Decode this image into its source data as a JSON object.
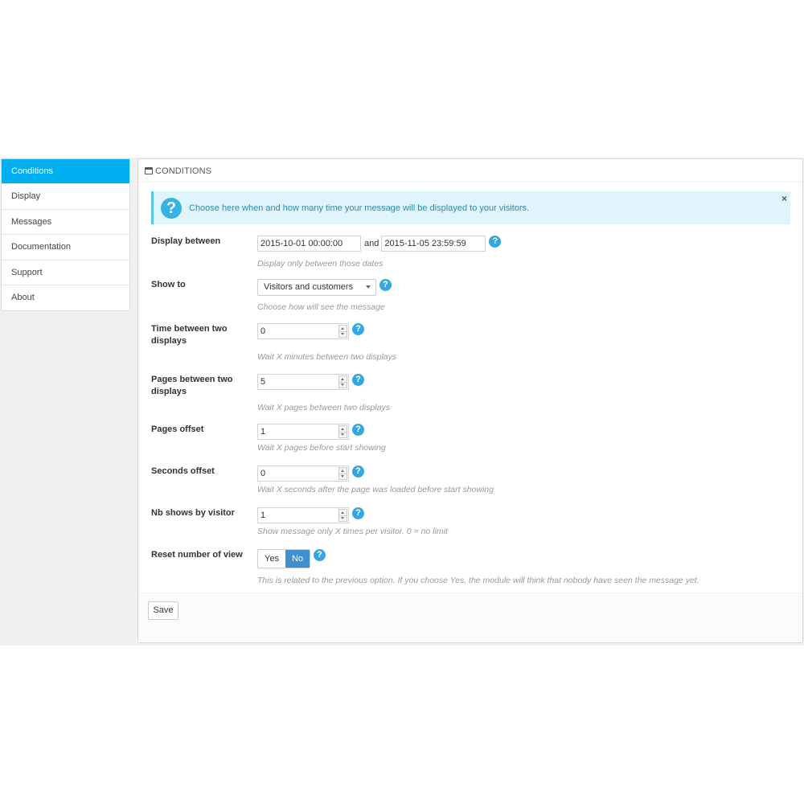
{
  "sidebar": {
    "items": [
      {
        "label": "Conditions",
        "active": true
      },
      {
        "label": "Display"
      },
      {
        "label": "Messages"
      },
      {
        "label": "Documentation"
      },
      {
        "label": "Support"
      },
      {
        "label": "About"
      }
    ]
  },
  "panel": {
    "title": "CONDITIONS",
    "alert": {
      "text": "Choose here when and how many time your message will be displayed to your visitors.",
      "close": "×"
    },
    "fields": {
      "display_between": {
        "label": "Display between",
        "from": "2015-10-01 00:00:00",
        "and": "and",
        "to": "2015-11-05 23:59:59",
        "hint": "Display only between those dates"
      },
      "show_to": {
        "label": "Show to",
        "value": "Visitors and customers",
        "hint": "Choose how will see the message"
      },
      "time_between": {
        "label": "Time between two displays",
        "value": "0",
        "hint": "Wait X minutes between two displays"
      },
      "pages_between": {
        "label": "Pages between two displays",
        "value": "5",
        "hint": "Wait X pages between two displays"
      },
      "pages_offset": {
        "label": "Pages offset",
        "value": "1",
        "hint": "Wait X pages before start showing"
      },
      "seconds_offset": {
        "label": "Seconds offset",
        "value": "0",
        "hint": "Wait X seconds after the page was loaded before start showing"
      },
      "nb_shows": {
        "label": "Nb shows by visitor",
        "value": "1",
        "hint": "Show message only X times per visitor. 0 = no limit"
      },
      "reset_views": {
        "label": "Reset number of view",
        "yes": "Yes",
        "no": "No",
        "selected": "No",
        "hint": "This is related to the previous option. If you choose Yes, the module will think that nobody have seen the message yet."
      }
    },
    "help_glyph": "?",
    "save_label": "Save"
  },
  "colors": {
    "active_tab": "#00aff0",
    "alert_bg": "#dff5fb",
    "help_icon": "#35a7e0",
    "toggle_on": "#3f8fd1"
  }
}
